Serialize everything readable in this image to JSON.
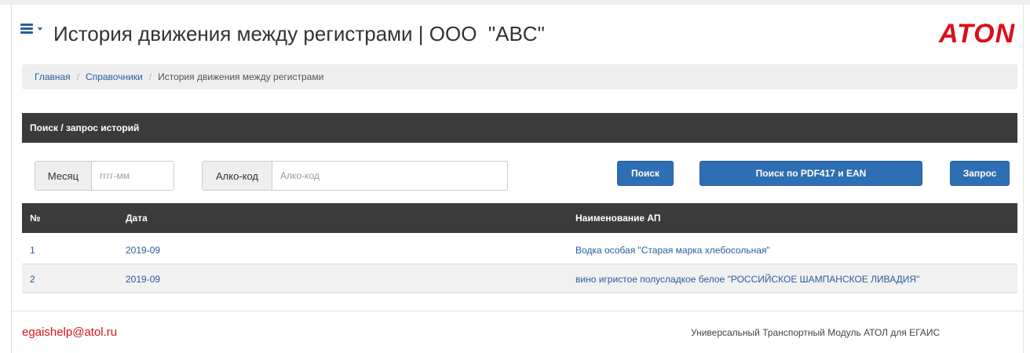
{
  "header": {
    "title": "История движения между регистрами | ООО  \"ABC\"",
    "logo_text": "ATON",
    "menu_icon": "hamburger-menu-icon"
  },
  "breadcrumb": {
    "items": [
      {
        "label": "Главная"
      },
      {
        "label": "Справочники"
      },
      {
        "label": "История движения между регистрами"
      }
    ]
  },
  "search_panel": {
    "title": "Поиск / запрос историй",
    "month": {
      "label": "Месяц",
      "placeholder": "гггг-мм",
      "value": ""
    },
    "alcocode": {
      "label": "Алко-код",
      "placeholder": "Алко-код",
      "value": ""
    },
    "buttons": {
      "search": "Поиск",
      "search_pdf": "Поиск по PDF417 и EAN",
      "request": "Запрос"
    }
  },
  "table": {
    "columns": [
      "№",
      "Дата",
      "Наименование АП"
    ],
    "rows": [
      {
        "num": "1",
        "date": "2019-09",
        "name": "Водка особая \"Старая марка хлебосольная\""
      },
      {
        "num": "2",
        "date": "2019-09",
        "name": "вино игристое полусладкое белое \"РОССИЙСКОЕ ШАМПАНСКОЕ ЛИВАДИЯ\""
      }
    ]
  },
  "footer": {
    "email": "egaishelp@atol.ru",
    "product": "Универсальный Транспортный Модуль АТОЛ для ЕГАИС"
  },
  "colors": {
    "brand_red": "#d9111a",
    "primary_blue": "#2e6eb3",
    "link_blue": "#2a5d9e",
    "dark_header": "#3b3b3b"
  }
}
